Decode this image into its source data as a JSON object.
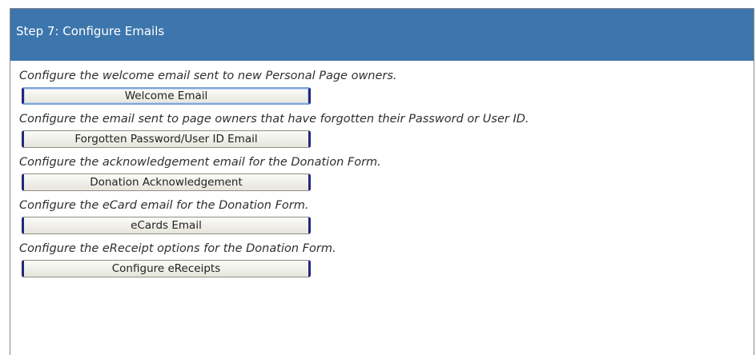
{
  "header": {
    "title": "Step 7: Configure Emails"
  },
  "sections": [
    {
      "description": "Configure the welcome email sent to new Personal Page owners.",
      "button_label": "Welcome Email"
    },
    {
      "description": "Configure the email sent to page owners that have forgotten their Password or User ID.",
      "button_label": "Forgotten Password/User ID Email"
    },
    {
      "description": "Configure the acknowledgement email for the Donation Form.",
      "button_label": "Donation Acknowledgement"
    },
    {
      "description": "Configure the eCard email for the Donation Form.",
      "button_label": "eCards Email"
    },
    {
      "description": "Configure the eReceipt options for the Donation Form.",
      "button_label": "Configure eReceipts"
    }
  ],
  "colors": {
    "header_bg": "#3c76ac",
    "header_text": "#ffffff",
    "button_edge": "#22287a"
  }
}
